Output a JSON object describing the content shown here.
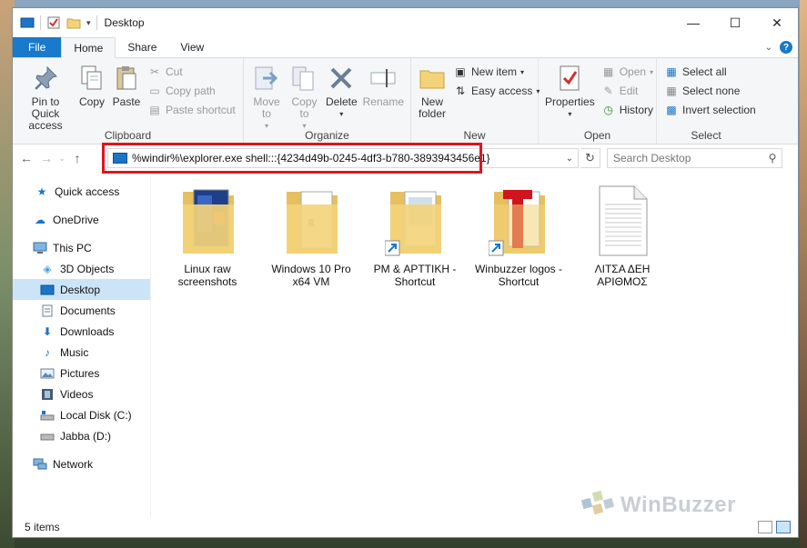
{
  "window": {
    "title": "Desktop"
  },
  "tabs": [
    {
      "label": "File"
    },
    {
      "label": "Home"
    },
    {
      "label": "Share"
    },
    {
      "label": "View"
    }
  ],
  "ribbon": {
    "clipboard": {
      "label": "Clipboard",
      "pin": "Pin to Quick access",
      "copy": "Copy",
      "paste": "Paste",
      "cut": "Cut",
      "copy_path": "Copy path",
      "paste_shortcut": "Paste shortcut"
    },
    "organize": {
      "label": "Organize",
      "move_to": "Move to",
      "copy_to": "Copy to",
      "delete": "Delete",
      "rename": "Rename"
    },
    "new": {
      "label": "New",
      "new_folder": "New folder",
      "new_item": "New item",
      "easy_access": "Easy access"
    },
    "open": {
      "label": "Open",
      "properties": "Properties",
      "open": "Open",
      "edit": "Edit",
      "history": "History"
    },
    "select": {
      "label": "Select",
      "select_all": "Select all",
      "select_none": "Select none",
      "invert_selection": "Invert selection"
    }
  },
  "address": {
    "value": "%windir%\\explorer.exe shell:::{4234d49b-0245-4df3-b780-3893943456e1}"
  },
  "search": {
    "placeholder": "Search Desktop"
  },
  "nav": {
    "items": [
      {
        "label": "Quick access"
      },
      {
        "label": "OneDrive"
      },
      {
        "label": "This PC"
      },
      {
        "label": "3D Objects"
      },
      {
        "label": "Desktop"
      },
      {
        "label": "Documents"
      },
      {
        "label": "Downloads"
      },
      {
        "label": "Music"
      },
      {
        "label": "Pictures"
      },
      {
        "label": "Videos"
      },
      {
        "label": "Local Disk (C:)"
      },
      {
        "label": "Jabba (D:)"
      },
      {
        "label": "Network"
      }
    ]
  },
  "files": [
    {
      "label": "Linux raw screenshots"
    },
    {
      "label": "Windows 10 Pro x64 VM"
    },
    {
      "label": "PM & ΑΡΤΤΙΚΗ - Shortcut"
    },
    {
      "label": "Winbuzzer logos - Shortcut"
    },
    {
      "label": "ΛΙΤΣΑ ΔΕΗ ΑΡΙΘΜΟΣ"
    }
  ],
  "status": {
    "items": "5 items"
  },
  "watermark": {
    "text": "WinBuzzer"
  },
  "colors": {
    "accent": "#1979ca",
    "highlight": "#e0141e",
    "folder": "#f3d37a",
    "selected": "#cce4f7"
  }
}
